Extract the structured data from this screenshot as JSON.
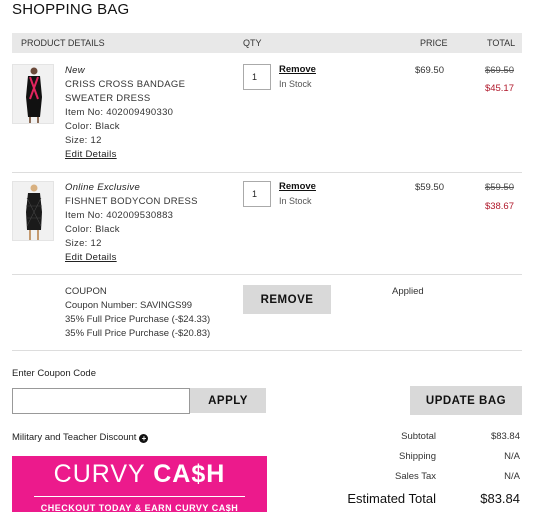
{
  "page": {
    "title": "SHOPPING BAG"
  },
  "table_header": {
    "product": "PRODUCT DETAILS",
    "qty": "QTY",
    "price": "PRICE",
    "total": "TOTAL"
  },
  "items": [
    {
      "tag": "New",
      "name_line1": "CRISS CROSS BANDAGE",
      "name_line2": "SWEATER DRESS",
      "item_no": "Item No: 402009490330",
      "color": "Color: Black",
      "size": "Size: 12",
      "edit": "Edit Details",
      "qty": "1",
      "remove": "Remove",
      "stock": "In Stock",
      "price": "$69.50",
      "original_total": "$69.50",
      "sale_total": "$45.17"
    },
    {
      "tag": "Online Exclusive",
      "name_line1": "FISHNET BODYCON DRESS",
      "name_line2": "",
      "item_no": "Item No: 402009530883",
      "color": "Color: Black",
      "size": "Size: 12",
      "edit": "Edit Details",
      "qty": "1",
      "remove": "Remove",
      "stock": "In Stock",
      "price": "$59.50",
      "original_total": "$59.50",
      "sale_total": "$38.67"
    }
  ],
  "coupon": {
    "heading": "COUPON",
    "number": "Coupon Number: SAVINGS99",
    "discount1": "35% Full Price Purchase (-$24.33)",
    "discount2": "35% Full Price Purchase (-$20.83)",
    "remove_button": "REMOVE",
    "status": "Applied"
  },
  "coupon_entry": {
    "label": "Enter Coupon Code",
    "value": "",
    "apply_button": "APPLY"
  },
  "update_button": "UPDATE BAG",
  "military": {
    "label": "Military and Teacher Discount",
    "icon": "plus-circle-icon"
  },
  "summary": {
    "subtotal_label": "Subtotal",
    "subtotal": "$83.84",
    "shipping_label": "Shipping",
    "shipping": "N/A",
    "tax_label": "Sales Tax",
    "tax": "N/A",
    "estimated_label": "Estimated Total",
    "estimated": "$83.84"
  },
  "banner": {
    "word1": "CURVY ",
    "word2": "CA$H",
    "subtitle": "CHECKOUT TODAY & EARN CURVY CA$H"
  },
  "colors": {
    "sale_red": "#b0182b",
    "banner_pink": "#ec1a8c",
    "header_gray": "#e8e8e8",
    "button_gray": "#d9d9d9"
  }
}
